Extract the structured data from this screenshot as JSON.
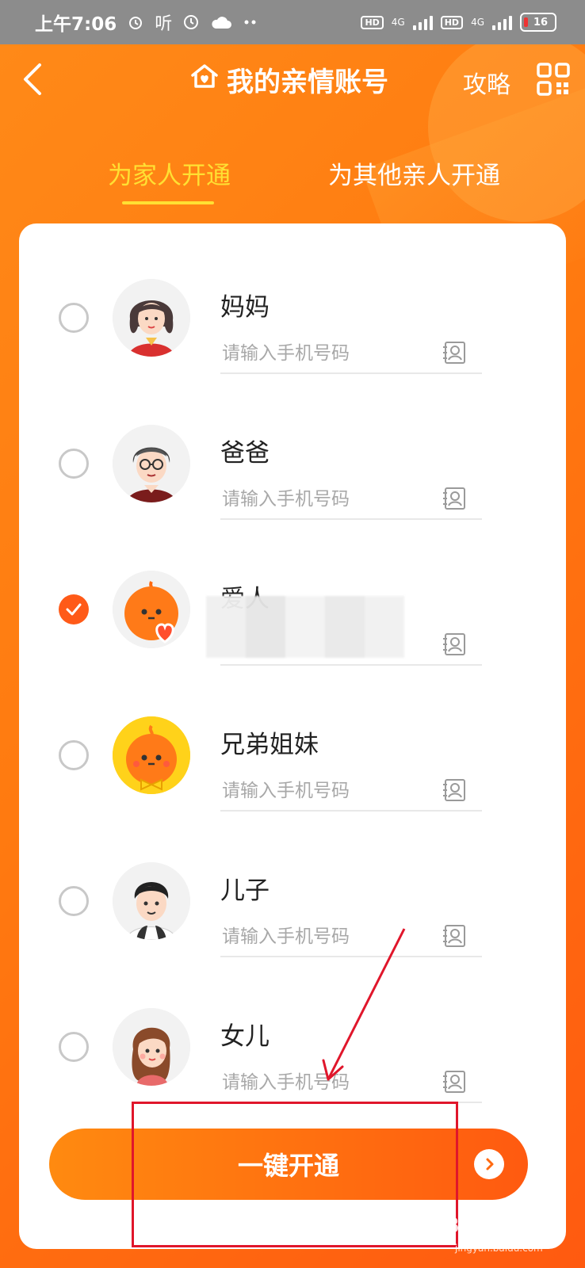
{
  "status_bar": {
    "time": "上午7:06",
    "listen_label": "听",
    "network_labels": [
      "HD",
      "4G",
      "HD",
      "4G"
    ],
    "battery": "16"
  },
  "header": {
    "title": "我的亲情账号",
    "guide_label": "攻略"
  },
  "tabs": [
    {
      "label": "为家人开通",
      "active": true
    },
    {
      "label": "为其他亲人开通",
      "active": false
    }
  ],
  "members": [
    {
      "name": "妈妈",
      "placeholder": "请输入手机号码",
      "checked": false,
      "avatar_icon": "mother-avatar"
    },
    {
      "name": "爸爸",
      "placeholder": "请输入手机号码",
      "checked": false,
      "avatar_icon": "father-avatar"
    },
    {
      "name": "爱人",
      "placeholder": "",
      "checked": true,
      "avatar_icon": "spouse-avatar"
    },
    {
      "name": "兄弟姐妹",
      "placeholder": "请输入手机号码",
      "checked": false,
      "avatar_icon": "siblings-avatar"
    },
    {
      "name": "儿子",
      "placeholder": "请输入手机号码",
      "checked": false,
      "avatar_icon": "son-avatar"
    },
    {
      "name": "女儿",
      "placeholder": "请输入手机号码",
      "checked": false,
      "avatar_icon": "daughter-avatar"
    }
  ],
  "action": {
    "open_label": "一键开通"
  },
  "watermark": {
    "brand": "Baidu经验",
    "url": "jingyan.baidu.com"
  },
  "colors": {
    "accent": "#ff6a10",
    "tab_active": "#ffe033",
    "annotation": "#e0162b"
  }
}
